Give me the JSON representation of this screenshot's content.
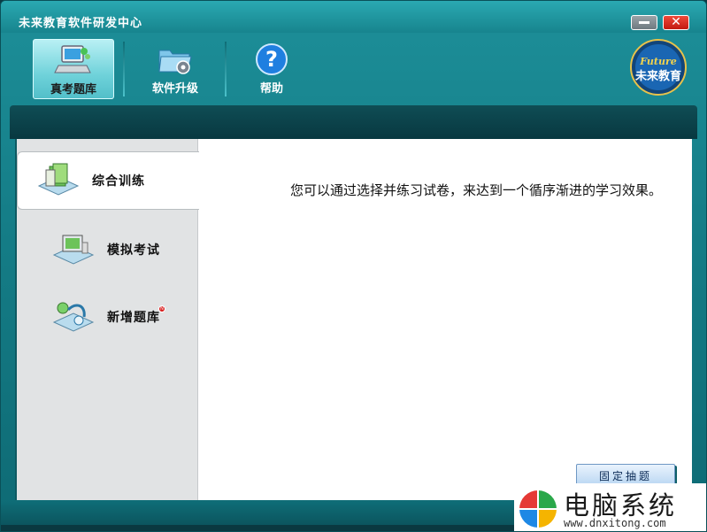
{
  "window": {
    "title": "未来教育软件研发中心"
  },
  "title_buttons": {
    "minimize_icon": "minimize-icon",
    "close_label": "✕"
  },
  "toolbar": {
    "items": [
      {
        "label": "真考题库",
        "icon": "computer-monitor-icon",
        "active": true
      },
      {
        "label": "软件升级",
        "icon": "folder-gear-icon",
        "active": false
      },
      {
        "label": "帮助",
        "icon": "help-question-icon",
        "active": false
      }
    ]
  },
  "logo": {
    "top_text": "Future",
    "main_text": "未来教育"
  },
  "sidebar": {
    "items": [
      {
        "label": "综合训练",
        "icon": "books-icon",
        "active": true
      },
      {
        "label": "模拟考试",
        "icon": "exam-monitor-icon",
        "active": false
      },
      {
        "label": "新增题库",
        "icon": "question-bank-icon",
        "active": false,
        "badge": "N"
      }
    ]
  },
  "main": {
    "description": "您可以通过选择并练习试卷，来达到一个循序渐进的学习效果。",
    "fixed_button_label": "固定抽题"
  },
  "watermark": {
    "text": "电脑系统",
    "url": "www.dnxitong.com"
  },
  "colors": {
    "accent": "#17848e",
    "dark_band": "#0b4149",
    "active_tool": "#6fd2da"
  }
}
